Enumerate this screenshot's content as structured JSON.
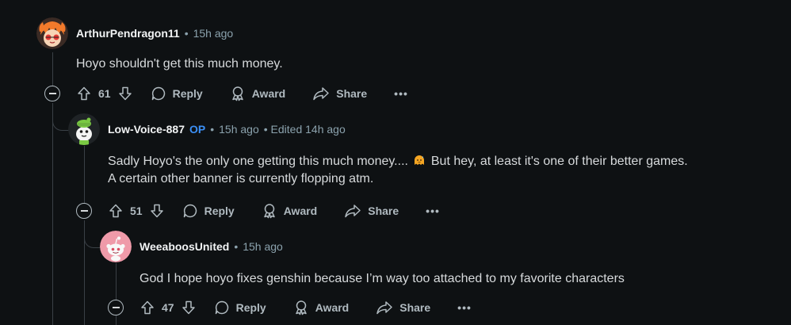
{
  "comments": [
    {
      "author": "ArthurPendragon11",
      "op_badge": "",
      "separator": "•",
      "time": "15h ago",
      "edited": "",
      "body_lines": [
        "Hoyo shouldn't get this much money."
      ],
      "votes": "61"
    },
    {
      "author": "Low-Voice-887",
      "op_badge": "OP",
      "separator": "•",
      "time": "15h ago",
      "edited": "• Edited 14h ago",
      "body_before_emoji": "Sadly Hoyo's the only one getting this much money....",
      "body_after_emoji": "But hey, at least it's one of their better games.",
      "body_line2": "A certain other banner is currently flopping atm.",
      "votes": "51"
    },
    {
      "author": "WeeaboosUnited",
      "op_badge": "",
      "separator": "•",
      "time": "15h ago",
      "edited": "",
      "body_lines": [
        "God I hope hoyo fixes genshin because I’m way too attached to my favorite characters"
      ],
      "votes": "47"
    }
  ],
  "actions": {
    "reply": "Reply",
    "award": "Award",
    "share": "Share",
    "more": "•••"
  },
  "icons": {
    "upvote": "arrow-up-outline-icon",
    "downvote": "arrow-down-outline-icon",
    "reply": "speech-bubble-icon",
    "award": "award-ribbon-icon",
    "share": "share-arrow-icon",
    "collapse": "minus-circle-icon",
    "emoji": "sweat-smile-ghost-emoji"
  },
  "colors": {
    "background": "#0e1113",
    "op_badge": "#3b8ff5",
    "muted_text": "#8ba2ad"
  }
}
